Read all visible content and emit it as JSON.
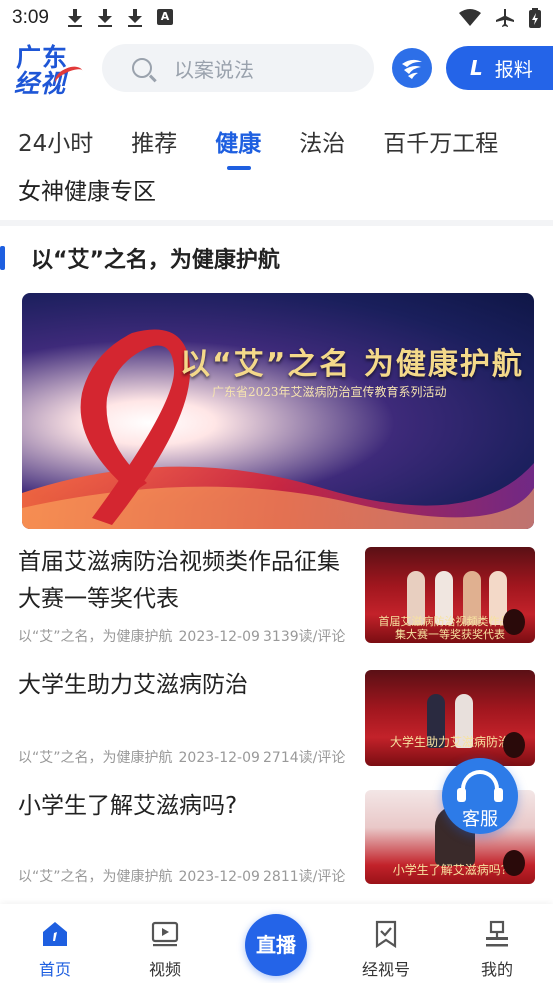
{
  "status_bar": {
    "time": "3:09",
    "indicator_a": "A"
  },
  "header": {
    "logo_line1": "广东",
    "logo_line2": "经视",
    "search_placeholder": "以案说法",
    "report_label": "报料",
    "report_glyph": "L"
  },
  "tabs": [
    {
      "label": "24小时",
      "active": false
    },
    {
      "label": "推荐",
      "active": false
    },
    {
      "label": "健康",
      "active": true
    },
    {
      "label": "法治",
      "active": false
    },
    {
      "label": "百千万工程",
      "active": false
    }
  ],
  "subtitle": "女神健康专区",
  "section": {
    "title": "以“艾”之名，为健康护航",
    "banner_title": "以“艾”之名 为健康护航",
    "banner_sub": "广东省2023年艾滋病防治宣传教育系列活动"
  },
  "news": [
    {
      "title": "首届艾滋病防治视频类作品征集大赛一等奖代表",
      "source": "以“艾”之名，为健康护航",
      "date": "2023-12-09",
      "reads": "3139读/评论",
      "thumb_caption": "首届艾滋病防治视频类作品征集大赛一等奖获奖代表"
    },
    {
      "title": "大学生助力艾滋病防治",
      "source": "以“艾”之名，为健康护航",
      "date": "2023-12-09",
      "reads": "2714读/评论",
      "thumb_caption": "大学生助力艾滋病防治"
    },
    {
      "title": "小学生了解艾滋病吗?",
      "source": "以“艾”之名，为健康护航",
      "date": "2023-12-09",
      "reads": "2811读/评论",
      "thumb_caption": "小学生了解艾滋病吗?"
    }
  ],
  "float_service": {
    "label": "客服"
  },
  "bottom_nav": {
    "home": "首页",
    "video": "视频",
    "live": "直播",
    "jingshihao": "经视号",
    "mine": "我的"
  },
  "colors": {
    "brand_blue": "#1e5fe0",
    "ribbon_red": "#d42630"
  }
}
